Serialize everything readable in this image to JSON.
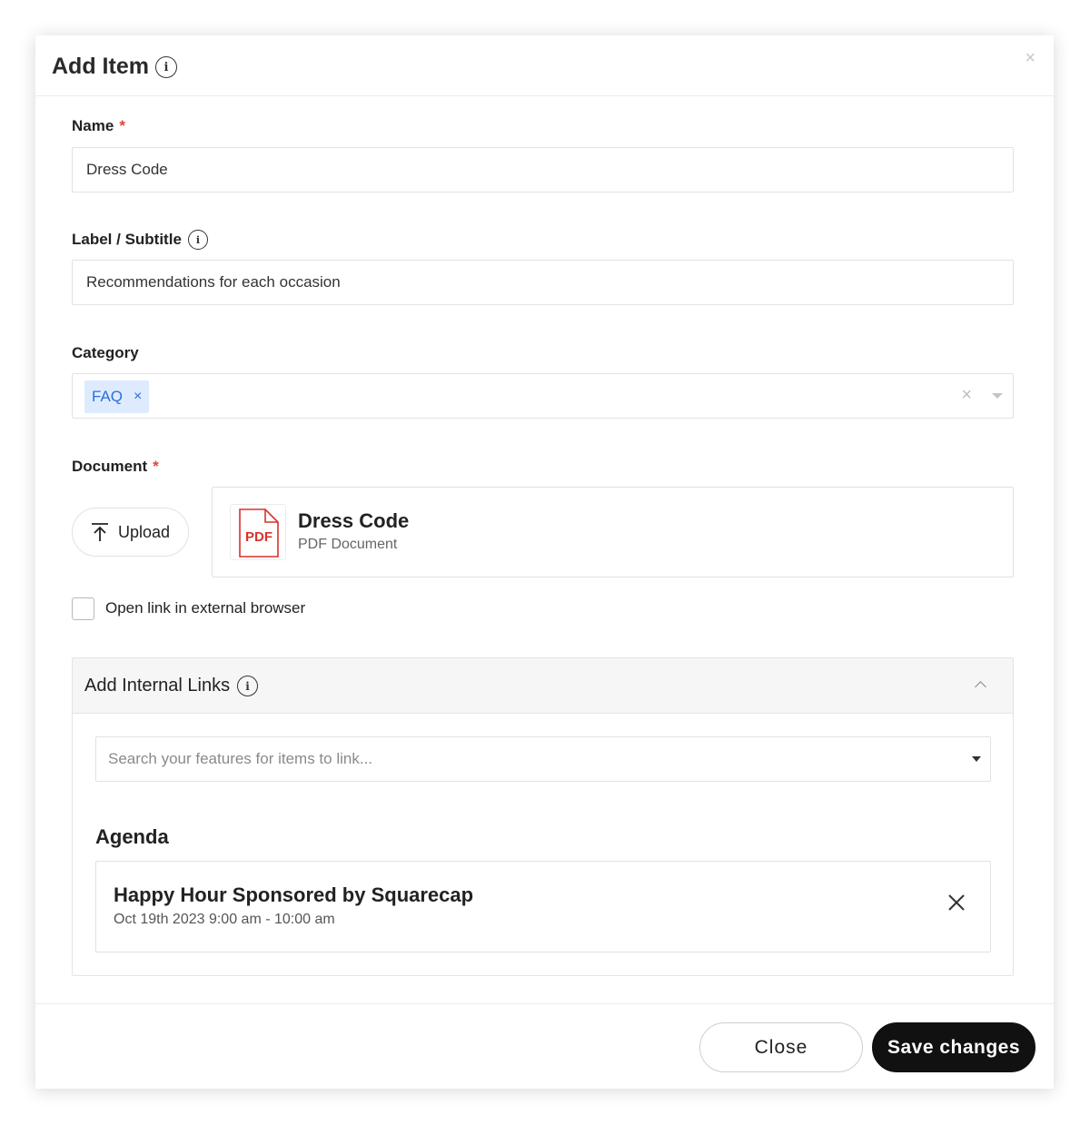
{
  "modal": {
    "title": "Add Item",
    "close_glyph": "×"
  },
  "fields": {
    "name": {
      "label": "Name",
      "required_mark": "*",
      "value": "Dress Code"
    },
    "label_subtitle": {
      "label": "Label / Subtitle",
      "value": "Recommendations for each occasion"
    },
    "category": {
      "label": "Category",
      "selected": [
        "FAQ"
      ],
      "chip_remove_glyph": "×",
      "clear_glyph": "×"
    },
    "document": {
      "label": "Document",
      "required_mark": "*",
      "upload_label": "Upload",
      "file_name": "Dress Code",
      "file_type": "PDF Document",
      "file_badge": "PDF"
    },
    "open_external": {
      "label": "Open link in external browser",
      "checked": false
    }
  },
  "internal_links": {
    "title": "Add Internal Links",
    "expanded": true,
    "search_placeholder": "Search your features for items to link...",
    "section": "Agenda",
    "items": [
      {
        "title": "Happy Hour Sponsored by Squarecap",
        "date": "Oct 19th 2023 9:00 am - 10:00 am"
      }
    ]
  },
  "footer": {
    "close_label": "Close",
    "save_label": "Save changes"
  },
  "colors": {
    "required": "#e0453a",
    "chip_bg": "#deebff",
    "chip_text": "#2b6fd6",
    "primary_button": "#111111",
    "pdf_red": "#d9312b"
  },
  "icons": [
    "info-icon",
    "close-icon",
    "upload-icon",
    "pdf-file-icon",
    "chevron-up-icon",
    "caret-down-icon"
  ]
}
